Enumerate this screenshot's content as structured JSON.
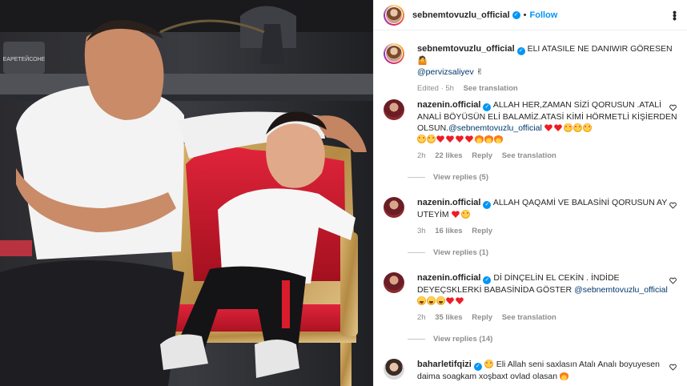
{
  "header": {
    "username": "sebnemtovuzlu_official",
    "separator": "•",
    "follow_label": "Follow",
    "more_icon": "more-options-icon"
  },
  "photo": {
    "watermark": "ЕАРЕТЕЙСОНЕ"
  },
  "caption": {
    "username": "sebnemtovuzlu_official",
    "text": "ELI ATASILE NE DANIWIR GÖRESEN🤷",
    "mention": "@pervizsaliyev",
    "tail": "✌",
    "edited": "Edited · 5h",
    "see_translation": "See translation"
  },
  "comments": [
    {
      "username": "nazenin.official",
      "text": "ALLAH HER,ZAMAN SİZİ QORUSUN .ATALİ ANALİ BÖYÜSÜN ELİ BALAMİZ.ATASİ KİMİ HÖRMETLİ KİŞİERDEN OLSUN.",
      "mention": "@sebnemtovuzlu_official",
      "time": "2h",
      "likes": "22 likes",
      "reply": "Reply",
      "see_translation": "See translation",
      "view_replies": "View replies (5)"
    },
    {
      "username": "nazenin.official",
      "text": "ALLAH QAQAMİ VE BALASİNİ QORUSUN AY UTEYİM",
      "time": "3h",
      "likes": "16 likes",
      "reply": "Reply",
      "view_replies": "View replies (1)"
    },
    {
      "username": "nazenin.official",
      "text": "Dİ DİNÇELİN EL CEKİN . İNDİDE DEYEÇSKLERKİ BABASİNİDA GÖSTER",
      "mention": "@sebnemtovuzlu_official",
      "time": "2h",
      "likes": "35 likes",
      "reply": "Reply",
      "see_translation": "See translation",
      "view_replies": "View replies (14)"
    },
    {
      "username": "baharletifqizi",
      "text": "Eli Allah seni saxlasın Atalı Analı boyuyesen daima soagkam xoşbaxt ovlad olasan"
    }
  ],
  "colors": {
    "link_blue": "#0095f6",
    "mention": "#00376b",
    "meta_gray": "#8e8e8e",
    "heart_red": "#ed1d24"
  }
}
